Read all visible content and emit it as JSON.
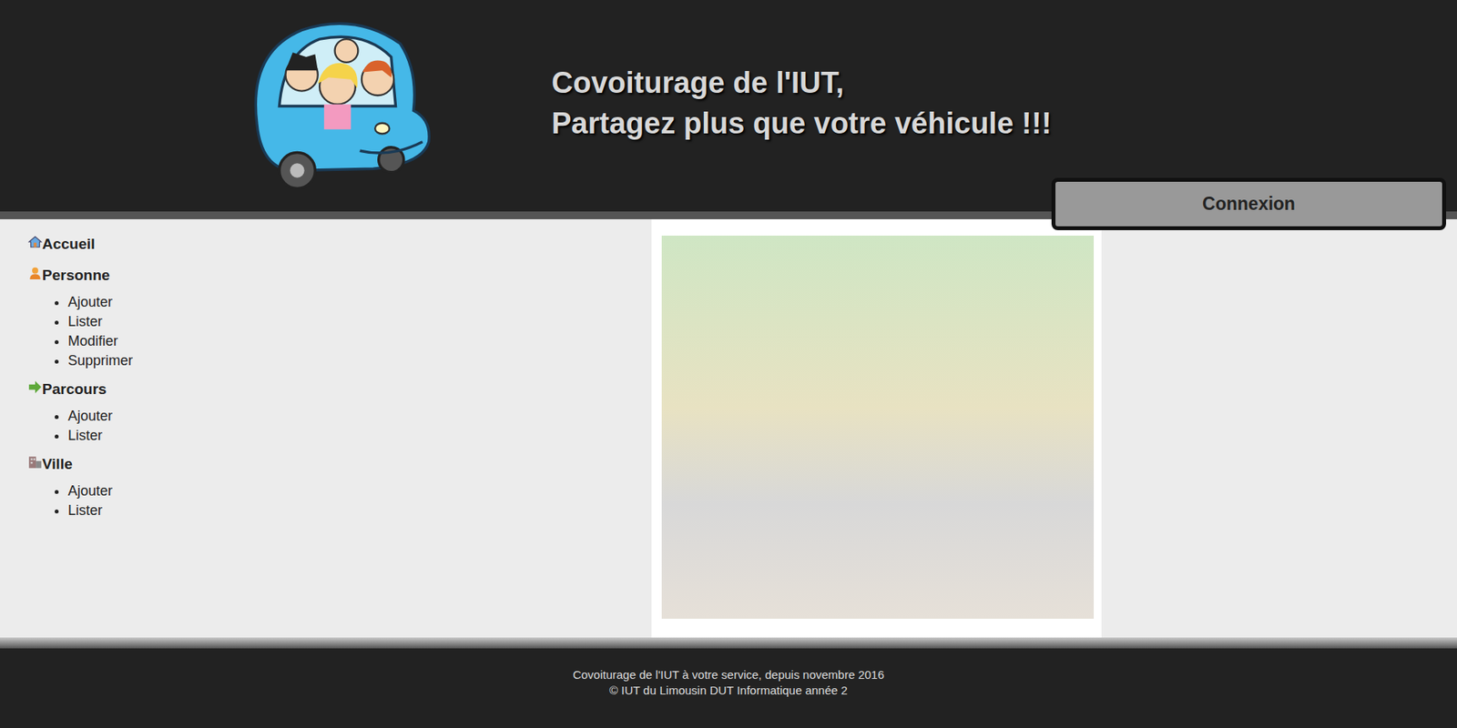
{
  "header": {
    "title_lines": [
      "Covoiturage de l'IUT,",
      "Partagez plus que votre véhicule !!!"
    ],
    "login_button": "Connexion"
  },
  "sidebar": {
    "sections": [
      {
        "label": "Accueil",
        "icon": "home",
        "items": []
      },
      {
        "label": "Personne",
        "icon": "person",
        "items": [
          "Ajouter",
          "Lister",
          "Modifier",
          "Supprimer"
        ]
      },
      {
        "label": "Parcours",
        "icon": "arrow",
        "items": [
          "Ajouter",
          "Lister"
        ]
      },
      {
        "label": "Ville",
        "icon": "building",
        "items": [
          "Ajouter",
          "Lister"
        ]
      }
    ]
  },
  "footer": {
    "lines": [
      "Covoiturage de l'IUT à votre service, depuis novembre 2016",
      "© IUT du Limousin DUT Informatique année 2"
    ]
  }
}
